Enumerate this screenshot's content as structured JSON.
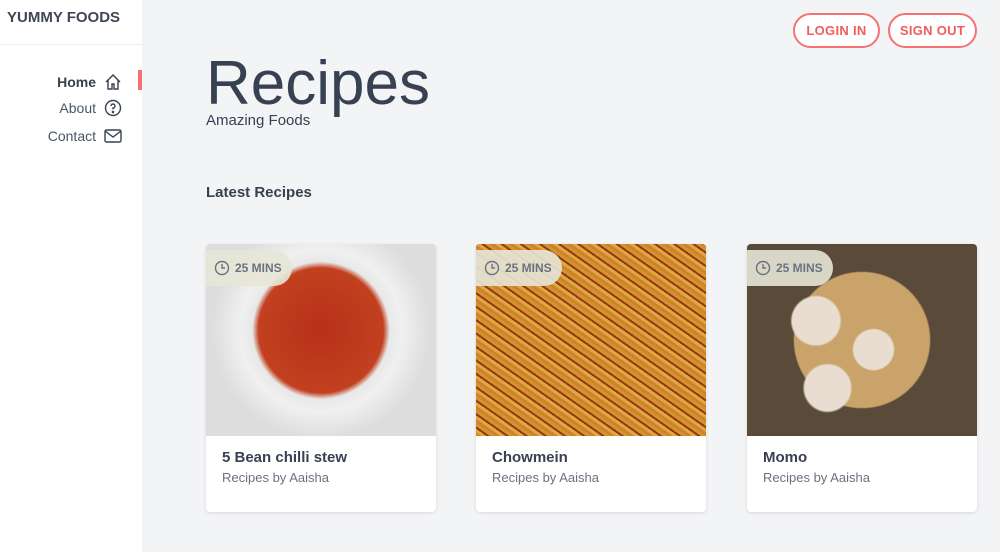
{
  "brand": "YUMMY FOODS",
  "nav": [
    {
      "label": "Home"
    },
    {
      "label": "About"
    },
    {
      "label": "Contact"
    }
  ],
  "header": {
    "login": "LOGIN IN",
    "signout": "SIGN OUT"
  },
  "hero": {
    "title": "Recipes",
    "subtitle": "Amazing Foods"
  },
  "section": "Latest Recipes",
  "recipes": [
    {
      "title": "5 Bean chilli stew",
      "author": "Recipes by Aaisha",
      "time": "25 MINS"
    },
    {
      "title": "Chowmein",
      "author": "Recipes by Aaisha",
      "time": "25 MINS"
    },
    {
      "title": "Momo",
      "author": "Recipes by Aaisha",
      "time": "25 MINS"
    }
  ]
}
